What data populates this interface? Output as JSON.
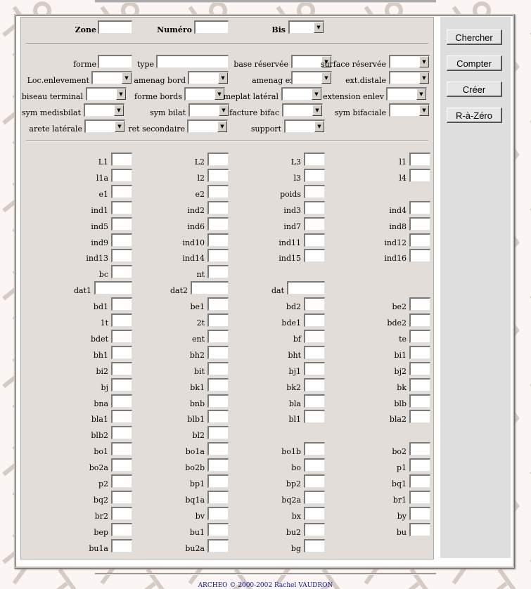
{
  "header": {
    "zone_label": "Zone",
    "numero_label": "Numéro",
    "bis_label": "Bis"
  },
  "dropdown_icon": "down-triangle-icon",
  "buttons": {
    "chercher": "Chercher",
    "compter": "Compter",
    "creer": "Créer",
    "raz": "R-à-Zéro"
  },
  "fields": {
    "forme": "forme",
    "type": "type",
    "base_reservee": "base réservée",
    "surface_reservee": "surface réservée",
    "loc_enlevement": "Loc.enlevement",
    "amenag_bord": "amenag bord",
    "amenag_ext_dist": "amenag ext.dist",
    "ext_distale": "ext.distale",
    "biseau_terminal": "biseau terminal",
    "forme_bords": "forme bords",
    "meplat_lateral": "meplat latéral",
    "extension_enlev": "extension enlev",
    "sym_medisbilat": "sym medisbilat",
    "sym_bilat": "sym bilat",
    "facture_bifac": "facture bifac",
    "sym_bifaciale": "sym bifaciale",
    "arete_laterale": "arete latérale",
    "ret_secondaire": "ret secondaire",
    "support": "support"
  },
  "measures": {
    "L1": "L1",
    "L2": "L2",
    "L3": "L3",
    "l1": "l1",
    "l1a": "l1a",
    "l2": "l2",
    "l3": "l3",
    "l4": "l4",
    "e1": "e1",
    "e2": "e2",
    "poids": "poids",
    "ind1": "ind1",
    "ind2": "ind2",
    "ind3": "ind3",
    "ind4": "ind4",
    "ind5": "ind5",
    "ind6": "ind6",
    "ind7": "ind7",
    "ind8": "ind8",
    "ind9": "ind9",
    "ind10": "ind10",
    "ind11": "ind11",
    "ind12": "ind12",
    "ind13": "ind13",
    "ind14": "ind14",
    "ind15": "ind15",
    "ind16": "ind16",
    "bc": "bc",
    "nt": "nt",
    "dat1": "dat1",
    "dat2": "dat2",
    "dat": "dat",
    "bd1": "bd1",
    "be1": "be1",
    "bd2": "bd2",
    "be2": "be2",
    "1t": "1t",
    "2t": "2t",
    "bde1": "bde1",
    "bde2": "bde2",
    "bdet": "bdet",
    "ent": "ent",
    "bf": "bf",
    "te": "te",
    "bh1": "bh1",
    "bh2": "bh2",
    "bht": "bht",
    "bi1": "bi1",
    "bi2": "bi2",
    "bit": "bit",
    "bj1": "bj1",
    "bj2": "bj2",
    "bj": "bj",
    "bk1": "bk1",
    "bk2": "bk2",
    "bk": "bk",
    "bna": "bna",
    "bnb": "bnb",
    "bla": "bla",
    "blb": "blb",
    "bla1": "bla1",
    "blb1": "blb1",
    "bl1": "bl1",
    "bla2": "bla2",
    "blb2": "blb2",
    "bl2": "bl2",
    "bo1": "bo1",
    "bo1a": "bo1a",
    "bo1b": "bo1b",
    "bo2": "bo2",
    "bo2a": "bo2a",
    "bo2b": "bo2b",
    "bo": "bo",
    "p1": "p1",
    "p2": "p2",
    "bp1": "bp1",
    "bp2": "bp2",
    "bq1": "bq1",
    "bq2": "bq2",
    "bq1a": "bq1a",
    "bq2a": "bq2a",
    "br1": "br1",
    "br2": "br2",
    "bv": "bv",
    "bx": "bx",
    "by": "by",
    "bep": "bep",
    "bu1": "bu1",
    "bu2": "bu2",
    "bu": "bu",
    "bu1a": "bu1a",
    "bu2a": "bu2a",
    "bg": "bg"
  },
  "footer": {
    "copyright": "ARCHEO © 2000-2002 Rachel VAUDRON"
  }
}
